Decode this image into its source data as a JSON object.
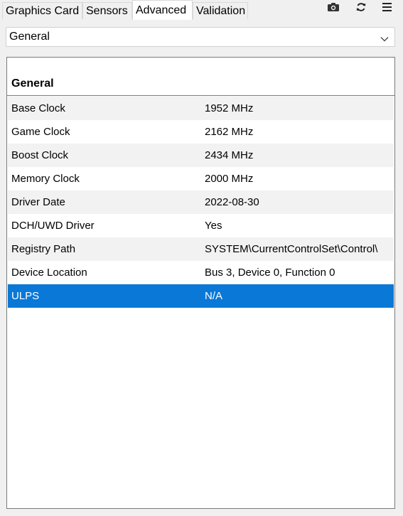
{
  "tabs": [
    {
      "label": "Graphics Card",
      "active": false
    },
    {
      "label": "Sensors",
      "active": false
    },
    {
      "label": "Advanced",
      "active": true
    },
    {
      "label": "Validation",
      "active": false
    }
  ],
  "toolbar_icons": [
    "camera-icon",
    "refresh-icon",
    "menu-icon"
  ],
  "dropdown": {
    "selected": "General"
  },
  "section": {
    "title": "General"
  },
  "rows": [
    {
      "label": "Base Clock",
      "value": "1952 MHz"
    },
    {
      "label": "Game Clock",
      "value": "2162 MHz"
    },
    {
      "label": "Boost Clock",
      "value": "2434 MHz"
    },
    {
      "label": "Memory Clock",
      "value": "2000 MHz"
    },
    {
      "label": "Driver Date",
      "value": "2022-08-30"
    },
    {
      "label": "DCH/UWD Driver",
      "value": "Yes"
    },
    {
      "label": "Registry Path",
      "value": "SYSTEM\\CurrentControlSet\\Control\\"
    },
    {
      "label": "Device Location",
      "value": "Bus 3, Device 0, Function 0"
    },
    {
      "label": "ULPS",
      "value": "N/A",
      "selected": true
    }
  ],
  "colors": {
    "selection": "#0a78d7",
    "row_alt": "#f2f2f2"
  }
}
